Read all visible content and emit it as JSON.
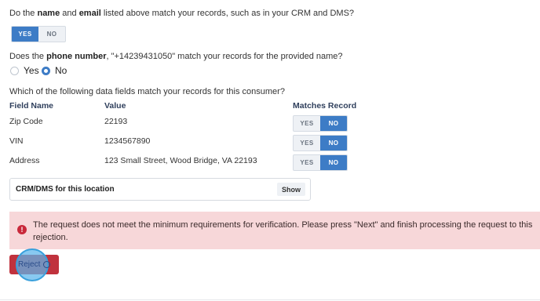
{
  "q1": {
    "pre": "Do the ",
    "b1": "name",
    "mid": " and ",
    "b2": "email",
    "post": " listed above match your records, such as in your CRM and DMS?"
  },
  "q1_toggle": {
    "yes": "YES",
    "no": "NO",
    "selected": "YES"
  },
  "q2": {
    "pre": "Does the ",
    "b1": "phone number",
    "post": ", \"+14239431050\" match your records for the provided name?"
  },
  "q2_radio": {
    "yes": "Yes",
    "no": "No",
    "selected": "No"
  },
  "q3": "Which of the following data fields match your records for this consumer?",
  "table": {
    "headers": {
      "field": "Field Name",
      "value": "Value",
      "matches": "Matches Record"
    },
    "rows": [
      {
        "field": "Zip Code",
        "value": "22193",
        "yes": "YES",
        "no": "NO",
        "selected": "NO"
      },
      {
        "field": "VIN",
        "value": "1234567890",
        "yes": "YES",
        "no": "NO",
        "selected": "NO"
      },
      {
        "field": "Address",
        "value": "123 Small Street, Wood Bridge, VA 22193",
        "yes": "YES",
        "no": "NO",
        "selected": "NO"
      }
    ]
  },
  "crm": {
    "title": "CRM/DMS for this location",
    "button": "Show"
  },
  "alert": {
    "icon": "!",
    "message": "The request does not meet the minimum requirements for verification. Please press \"Next\" and finish processing the request to this rejection."
  },
  "reject": {
    "label": "Reject"
  },
  "colors": {
    "accent": "#3d7cc6",
    "danger": "#c0323d",
    "alert_bg": "#f7d7d9"
  }
}
